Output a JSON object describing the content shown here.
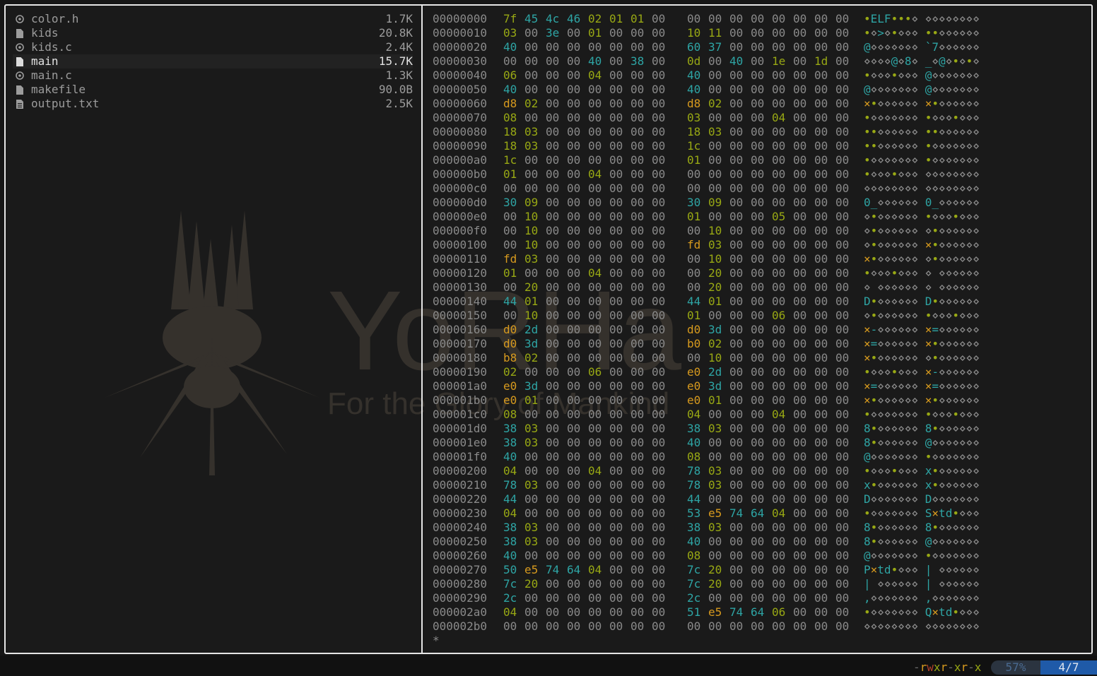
{
  "files": [
    {
      "name": "color.h",
      "size": "1.7K",
      "icon": "c-file-icon",
      "selected": false
    },
    {
      "name": "kids",
      "size": "20.8K",
      "icon": "file-icon",
      "selected": false
    },
    {
      "name": "kids.c",
      "size": "2.4K",
      "icon": "c-file-icon",
      "selected": false
    },
    {
      "name": "main",
      "size": "15.7K",
      "icon": "file-icon",
      "selected": true
    },
    {
      "name": "main.c",
      "size": "1.3K",
      "icon": "c-file-icon",
      "selected": false
    },
    {
      "name": "makefile",
      "size": "90.0B",
      "icon": "file-icon",
      "selected": false
    },
    {
      "name": "output.txt",
      "size": "2.5K",
      "icon": "text-file-icon",
      "selected": false
    }
  ],
  "hexdump": [
    {
      "offset": "00000000",
      "bytes": [
        "7f",
        "45",
        "4c",
        "46",
        "02",
        "01",
        "01",
        "00",
        "00",
        "00",
        "00",
        "00",
        "00",
        "00",
        "00",
        "00"
      ],
      "ascii": "•ELF•••⋄ ⋄⋄⋄⋄⋄⋄⋄⋄"
    },
    {
      "offset": "00000010",
      "bytes": [
        "03",
        "00",
        "3e",
        "00",
        "01",
        "00",
        "00",
        "00",
        "10",
        "11",
        "00",
        "00",
        "00",
        "00",
        "00",
        "00"
      ],
      "ascii": "•⋄>⋄•⋄⋄⋄ ••⋄⋄⋄⋄⋄⋄"
    },
    {
      "offset": "00000020",
      "bytes": [
        "40",
        "00",
        "00",
        "00",
        "00",
        "00",
        "00",
        "00",
        "60",
        "37",
        "00",
        "00",
        "00",
        "00",
        "00",
        "00"
      ],
      "ascii": "@⋄⋄⋄⋄⋄⋄⋄ `7⋄⋄⋄⋄⋄⋄"
    },
    {
      "offset": "00000030",
      "bytes": [
        "00",
        "00",
        "00",
        "00",
        "40",
        "00",
        "38",
        "00",
        "0d",
        "00",
        "40",
        "00",
        "1e",
        "00",
        "1d",
        "00"
      ],
      "ascii": "⋄⋄⋄⋄@⋄8⋄ _⋄@⋄•⋄•⋄"
    },
    {
      "offset": "00000040",
      "bytes": [
        "06",
        "00",
        "00",
        "00",
        "04",
        "00",
        "00",
        "00",
        "40",
        "00",
        "00",
        "00",
        "00",
        "00",
        "00",
        "00"
      ],
      "ascii": "•⋄⋄⋄•⋄⋄⋄ @⋄⋄⋄⋄⋄⋄⋄"
    },
    {
      "offset": "00000050",
      "bytes": [
        "40",
        "00",
        "00",
        "00",
        "00",
        "00",
        "00",
        "00",
        "40",
        "00",
        "00",
        "00",
        "00",
        "00",
        "00",
        "00"
      ],
      "ascii": "@⋄⋄⋄⋄⋄⋄⋄ @⋄⋄⋄⋄⋄⋄⋄"
    },
    {
      "offset": "00000060",
      "bytes": [
        "d8",
        "02",
        "00",
        "00",
        "00",
        "00",
        "00",
        "00",
        "d8",
        "02",
        "00",
        "00",
        "00",
        "00",
        "00",
        "00"
      ],
      "ascii": "×•⋄⋄⋄⋄⋄⋄ ×•⋄⋄⋄⋄⋄⋄"
    },
    {
      "offset": "00000070",
      "bytes": [
        "08",
        "00",
        "00",
        "00",
        "00",
        "00",
        "00",
        "00",
        "03",
        "00",
        "00",
        "00",
        "04",
        "00",
        "00",
        "00"
      ],
      "ascii": "•⋄⋄⋄⋄⋄⋄⋄ •⋄⋄⋄•⋄⋄⋄"
    },
    {
      "offset": "00000080",
      "bytes": [
        "18",
        "03",
        "00",
        "00",
        "00",
        "00",
        "00",
        "00",
        "18",
        "03",
        "00",
        "00",
        "00",
        "00",
        "00",
        "00"
      ],
      "ascii": "••⋄⋄⋄⋄⋄⋄ ••⋄⋄⋄⋄⋄⋄"
    },
    {
      "offset": "00000090",
      "bytes": [
        "18",
        "03",
        "00",
        "00",
        "00",
        "00",
        "00",
        "00",
        "1c",
        "00",
        "00",
        "00",
        "00",
        "00",
        "00",
        "00"
      ],
      "ascii": "••⋄⋄⋄⋄⋄⋄ •⋄⋄⋄⋄⋄⋄⋄"
    },
    {
      "offset": "000000a0",
      "bytes": [
        "1c",
        "00",
        "00",
        "00",
        "00",
        "00",
        "00",
        "00",
        "01",
        "00",
        "00",
        "00",
        "00",
        "00",
        "00",
        "00"
      ],
      "ascii": "•⋄⋄⋄⋄⋄⋄⋄ •⋄⋄⋄⋄⋄⋄⋄"
    },
    {
      "offset": "000000b0",
      "bytes": [
        "01",
        "00",
        "00",
        "00",
        "04",
        "00",
        "00",
        "00",
        "00",
        "00",
        "00",
        "00",
        "00",
        "00",
        "00",
        "00"
      ],
      "ascii": "•⋄⋄⋄•⋄⋄⋄ ⋄⋄⋄⋄⋄⋄⋄⋄"
    },
    {
      "offset": "000000c0",
      "bytes": [
        "00",
        "00",
        "00",
        "00",
        "00",
        "00",
        "00",
        "00",
        "00",
        "00",
        "00",
        "00",
        "00",
        "00",
        "00",
        "00"
      ],
      "ascii": "⋄⋄⋄⋄⋄⋄⋄⋄ ⋄⋄⋄⋄⋄⋄⋄⋄"
    },
    {
      "offset": "000000d0",
      "bytes": [
        "30",
        "09",
        "00",
        "00",
        "00",
        "00",
        "00",
        "00",
        "30",
        "09",
        "00",
        "00",
        "00",
        "00",
        "00",
        "00"
      ],
      "ascii": "0_⋄⋄⋄⋄⋄⋄ 0_⋄⋄⋄⋄⋄⋄"
    },
    {
      "offset": "000000e0",
      "bytes": [
        "00",
        "10",
        "00",
        "00",
        "00",
        "00",
        "00",
        "00",
        "01",
        "00",
        "00",
        "00",
        "05",
        "00",
        "00",
        "00"
      ],
      "ascii": "⋄•⋄⋄⋄⋄⋄⋄ •⋄⋄⋄•⋄⋄⋄"
    },
    {
      "offset": "000000f0",
      "bytes": [
        "00",
        "10",
        "00",
        "00",
        "00",
        "00",
        "00",
        "00",
        "00",
        "10",
        "00",
        "00",
        "00",
        "00",
        "00",
        "00"
      ],
      "ascii": "⋄•⋄⋄⋄⋄⋄⋄ ⋄•⋄⋄⋄⋄⋄⋄"
    },
    {
      "offset": "00000100",
      "bytes": [
        "00",
        "10",
        "00",
        "00",
        "00",
        "00",
        "00",
        "00",
        "fd",
        "03",
        "00",
        "00",
        "00",
        "00",
        "00",
        "00"
      ],
      "ascii": "⋄•⋄⋄⋄⋄⋄⋄ ×•⋄⋄⋄⋄⋄⋄"
    },
    {
      "offset": "00000110",
      "bytes": [
        "fd",
        "03",
        "00",
        "00",
        "00",
        "00",
        "00",
        "00",
        "00",
        "10",
        "00",
        "00",
        "00",
        "00",
        "00",
        "00"
      ],
      "ascii": "×•⋄⋄⋄⋄⋄⋄ ⋄•⋄⋄⋄⋄⋄⋄"
    },
    {
      "offset": "00000120",
      "bytes": [
        "01",
        "00",
        "00",
        "00",
        "04",
        "00",
        "00",
        "00",
        "00",
        "20",
        "00",
        "00",
        "00",
        "00",
        "00",
        "00"
      ],
      "ascii": "•⋄⋄⋄•⋄⋄⋄ ⋄ ⋄⋄⋄⋄⋄⋄"
    },
    {
      "offset": "00000130",
      "bytes": [
        "00",
        "20",
        "00",
        "00",
        "00",
        "00",
        "00",
        "00",
        "00",
        "20",
        "00",
        "00",
        "00",
        "00",
        "00",
        "00"
      ],
      "ascii": "⋄ ⋄⋄⋄⋄⋄⋄ ⋄ ⋄⋄⋄⋄⋄⋄"
    },
    {
      "offset": "00000140",
      "bytes": [
        "44",
        "01",
        "00",
        "00",
        "00",
        "00",
        "00",
        "00",
        "44",
        "01",
        "00",
        "00",
        "00",
        "00",
        "00",
        "00"
      ],
      "ascii": "D•⋄⋄⋄⋄⋄⋄ D•⋄⋄⋄⋄⋄⋄"
    },
    {
      "offset": "00000150",
      "bytes": [
        "00",
        "10",
        "00",
        "00",
        "00",
        "00",
        "00",
        "00",
        "01",
        "00",
        "00",
        "00",
        "06",
        "00",
        "00",
        "00"
      ],
      "ascii": "⋄•⋄⋄⋄⋄⋄⋄ •⋄⋄⋄•⋄⋄⋄"
    },
    {
      "offset": "00000160",
      "bytes": [
        "d0",
        "2d",
        "00",
        "00",
        "00",
        "00",
        "00",
        "00",
        "d0",
        "3d",
        "00",
        "00",
        "00",
        "00",
        "00",
        "00"
      ],
      "ascii": "×-⋄⋄⋄⋄⋄⋄ ×=⋄⋄⋄⋄⋄⋄"
    },
    {
      "offset": "00000170",
      "bytes": [
        "d0",
        "3d",
        "00",
        "00",
        "00",
        "00",
        "00",
        "00",
        "b0",
        "02",
        "00",
        "00",
        "00",
        "00",
        "00",
        "00"
      ],
      "ascii": "×=⋄⋄⋄⋄⋄⋄ ×•⋄⋄⋄⋄⋄⋄"
    },
    {
      "offset": "00000180",
      "bytes": [
        "b8",
        "02",
        "00",
        "00",
        "00",
        "00",
        "00",
        "00",
        "00",
        "10",
        "00",
        "00",
        "00",
        "00",
        "00",
        "00"
      ],
      "ascii": "×•⋄⋄⋄⋄⋄⋄ ⋄•⋄⋄⋄⋄⋄⋄"
    },
    {
      "offset": "00000190",
      "bytes": [
        "02",
        "00",
        "00",
        "00",
        "06",
        "00",
        "00",
        "00",
        "e0",
        "2d",
        "00",
        "00",
        "00",
        "00",
        "00",
        "00"
      ],
      "ascii": "•⋄⋄⋄•⋄⋄⋄ ×-⋄⋄⋄⋄⋄⋄"
    },
    {
      "offset": "000001a0",
      "bytes": [
        "e0",
        "3d",
        "00",
        "00",
        "00",
        "00",
        "00",
        "00",
        "e0",
        "3d",
        "00",
        "00",
        "00",
        "00",
        "00",
        "00"
      ],
      "ascii": "×=⋄⋄⋄⋄⋄⋄ ×=⋄⋄⋄⋄⋄⋄"
    },
    {
      "offset": "000001b0",
      "bytes": [
        "e0",
        "01",
        "00",
        "00",
        "00",
        "00",
        "00",
        "00",
        "e0",
        "01",
        "00",
        "00",
        "00",
        "00",
        "00",
        "00"
      ],
      "ascii": "×•⋄⋄⋄⋄⋄⋄ ×•⋄⋄⋄⋄⋄⋄"
    },
    {
      "offset": "000001c0",
      "bytes": [
        "08",
        "00",
        "00",
        "00",
        "00",
        "00",
        "00",
        "00",
        "04",
        "00",
        "00",
        "00",
        "04",
        "00",
        "00",
        "00"
      ],
      "ascii": "•⋄⋄⋄⋄⋄⋄⋄ •⋄⋄⋄•⋄⋄⋄"
    },
    {
      "offset": "000001d0",
      "bytes": [
        "38",
        "03",
        "00",
        "00",
        "00",
        "00",
        "00",
        "00",
        "38",
        "03",
        "00",
        "00",
        "00",
        "00",
        "00",
        "00"
      ],
      "ascii": "8•⋄⋄⋄⋄⋄⋄ 8•⋄⋄⋄⋄⋄⋄"
    },
    {
      "offset": "000001e0",
      "bytes": [
        "38",
        "03",
        "00",
        "00",
        "00",
        "00",
        "00",
        "00",
        "40",
        "00",
        "00",
        "00",
        "00",
        "00",
        "00",
        "00"
      ],
      "ascii": "8•⋄⋄⋄⋄⋄⋄ @⋄⋄⋄⋄⋄⋄⋄"
    },
    {
      "offset": "000001f0",
      "bytes": [
        "40",
        "00",
        "00",
        "00",
        "00",
        "00",
        "00",
        "00",
        "08",
        "00",
        "00",
        "00",
        "00",
        "00",
        "00",
        "00"
      ],
      "ascii": "@⋄⋄⋄⋄⋄⋄⋄ •⋄⋄⋄⋄⋄⋄⋄"
    },
    {
      "offset": "00000200",
      "bytes": [
        "04",
        "00",
        "00",
        "00",
        "04",
        "00",
        "00",
        "00",
        "78",
        "03",
        "00",
        "00",
        "00",
        "00",
        "00",
        "00"
      ],
      "ascii": "•⋄⋄⋄•⋄⋄⋄ x•⋄⋄⋄⋄⋄⋄"
    },
    {
      "offset": "00000210",
      "bytes": [
        "78",
        "03",
        "00",
        "00",
        "00",
        "00",
        "00",
        "00",
        "78",
        "03",
        "00",
        "00",
        "00",
        "00",
        "00",
        "00"
      ],
      "ascii": "x•⋄⋄⋄⋄⋄⋄ x•⋄⋄⋄⋄⋄⋄"
    },
    {
      "offset": "00000220",
      "bytes": [
        "44",
        "00",
        "00",
        "00",
        "00",
        "00",
        "00",
        "00",
        "44",
        "00",
        "00",
        "00",
        "00",
        "00",
        "00",
        "00"
      ],
      "ascii": "D⋄⋄⋄⋄⋄⋄⋄ D⋄⋄⋄⋄⋄⋄⋄"
    },
    {
      "offset": "00000230",
      "bytes": [
        "04",
        "00",
        "00",
        "00",
        "00",
        "00",
        "00",
        "00",
        "53",
        "e5",
        "74",
        "64",
        "04",
        "00",
        "00",
        "00"
      ],
      "ascii": "•⋄⋄⋄⋄⋄⋄⋄ S×td•⋄⋄⋄"
    },
    {
      "offset": "00000240",
      "bytes": [
        "38",
        "03",
        "00",
        "00",
        "00",
        "00",
        "00",
        "00",
        "38",
        "03",
        "00",
        "00",
        "00",
        "00",
        "00",
        "00"
      ],
      "ascii": "8•⋄⋄⋄⋄⋄⋄ 8•⋄⋄⋄⋄⋄⋄"
    },
    {
      "offset": "00000250",
      "bytes": [
        "38",
        "03",
        "00",
        "00",
        "00",
        "00",
        "00",
        "00",
        "40",
        "00",
        "00",
        "00",
        "00",
        "00",
        "00",
        "00"
      ],
      "ascii": "8•⋄⋄⋄⋄⋄⋄ @⋄⋄⋄⋄⋄⋄⋄"
    },
    {
      "offset": "00000260",
      "bytes": [
        "40",
        "00",
        "00",
        "00",
        "00",
        "00",
        "00",
        "00",
        "08",
        "00",
        "00",
        "00",
        "00",
        "00",
        "00",
        "00"
      ],
      "ascii": "@⋄⋄⋄⋄⋄⋄⋄ •⋄⋄⋄⋄⋄⋄⋄"
    },
    {
      "offset": "00000270",
      "bytes": [
        "50",
        "e5",
        "74",
        "64",
        "04",
        "00",
        "00",
        "00",
        "7c",
        "20",
        "00",
        "00",
        "00",
        "00",
        "00",
        "00"
      ],
      "ascii": "P×td•⋄⋄⋄ | ⋄⋄⋄⋄⋄⋄"
    },
    {
      "offset": "00000280",
      "bytes": [
        "7c",
        "20",
        "00",
        "00",
        "00",
        "00",
        "00",
        "00",
        "7c",
        "20",
        "00",
        "00",
        "00",
        "00",
        "00",
        "00"
      ],
      "ascii": "| ⋄⋄⋄⋄⋄⋄ | ⋄⋄⋄⋄⋄⋄"
    },
    {
      "offset": "00000290",
      "bytes": [
        "2c",
        "00",
        "00",
        "00",
        "00",
        "00",
        "00",
        "00",
        "2c",
        "00",
        "00",
        "00",
        "00",
        "00",
        "00",
        "00"
      ],
      "ascii": ",⋄⋄⋄⋄⋄⋄⋄ ,⋄⋄⋄⋄⋄⋄⋄"
    },
    {
      "offset": "000002a0",
      "bytes": [
        "04",
        "00",
        "00",
        "00",
        "00",
        "00",
        "00",
        "00",
        "51",
        "e5",
        "74",
        "64",
        "06",
        "00",
        "00",
        "00"
      ],
      "ascii": "•⋄⋄⋄⋄⋄⋄⋄ Q×td•⋄⋄⋄"
    },
    {
      "offset": "000002b0",
      "bytes": [
        "00",
        "00",
        "00",
        "00",
        "00",
        "00",
        "00",
        "00",
        "00",
        "00",
        "00",
        "00",
        "00",
        "00",
        "00",
        "00"
      ],
      "ascii": "⋄⋄⋄⋄⋄⋄⋄⋄ ⋄⋄⋄⋄⋄⋄⋄⋄"
    }
  ],
  "hexdump_end": "*",
  "wallpaper": {
    "title": "YoRHa",
    "subtitle": "For the Glory of Mankind"
  },
  "status": {
    "permissions": "-rwxr-xr-x",
    "percent": "57%",
    "position": "4/7"
  },
  "colors": {
    "null": "#8a8a8a",
    "printable": "#2ea5a5",
    "high": "#d79a1e",
    "control": "#98a814",
    "accent": "#1f5aa8"
  }
}
